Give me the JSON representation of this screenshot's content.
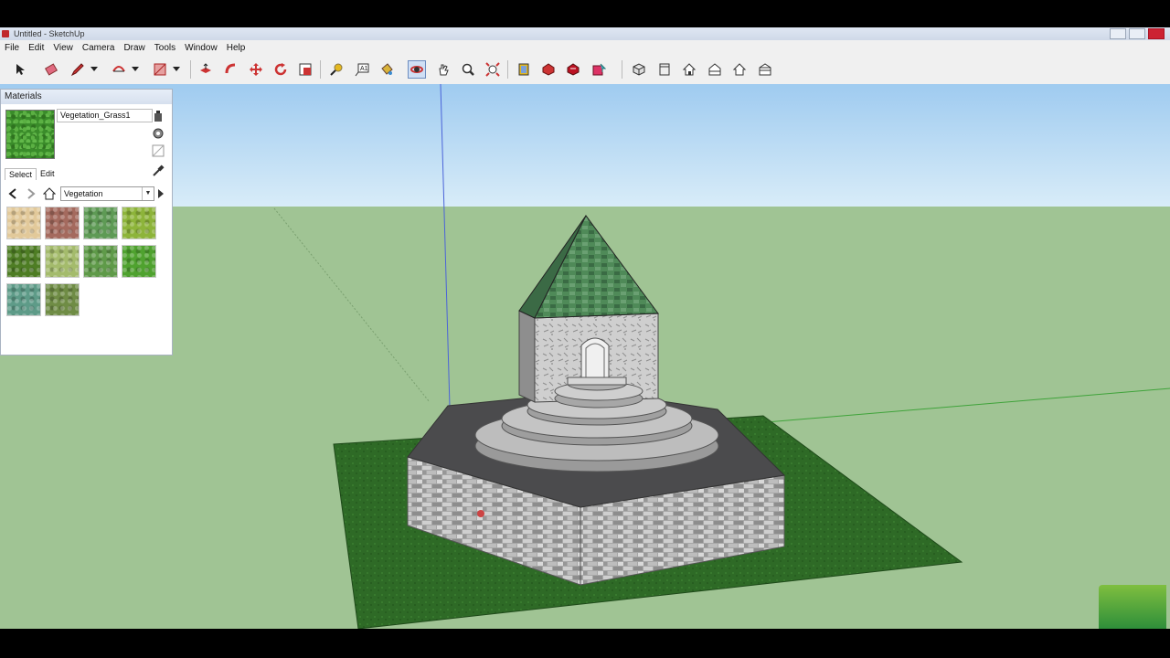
{
  "window": {
    "title": "Untitled - SketchUp"
  },
  "menu": [
    "File",
    "Edit",
    "View",
    "Camera",
    "Draw",
    "Tools",
    "Window",
    "Help"
  ],
  "toolbar": {
    "tools": [
      "select-icon",
      "eraser-icon",
      "pencil-icon",
      "pencil-dropdown-icon",
      "arc-icon",
      "arc-dropdown-icon",
      "rectangle-icon",
      "rectangle-dropdown-icon",
      "push-pull-icon",
      "follow-me-icon",
      "move-icon",
      "rotate-icon",
      "scale-icon",
      "tape-measure-icon",
      "text-icon",
      "paint-bucket-icon",
      "orbit-icon",
      "pan-icon",
      "zoom-icon",
      "zoom-extents-icon",
      "components-icon",
      "get-models-icon",
      "share-model-icon",
      "upload-icon",
      "iso-view-icon",
      "top-view-icon",
      "front-view-icon",
      "right-view-icon",
      "back-view-icon",
      "left-view-icon"
    ],
    "active_tool": "orbit-icon"
  },
  "materials": {
    "title": "Materials",
    "current_material": "Vegetation_Grass1",
    "tabs": [
      "Select",
      "Edit"
    ],
    "selected_tab": "Select",
    "library": "Vegetation",
    "swatches": [
      {
        "name": "sand",
        "color": "#e2c99a"
      },
      {
        "name": "brown-stones",
        "color": "#a46a5e"
      },
      {
        "name": "green-leaves",
        "color": "#5e9a55"
      },
      {
        "name": "moss",
        "color": "#8db43a"
      },
      {
        "name": "dark-moss",
        "color": "#4e7d24"
      },
      {
        "name": "pale-grass",
        "color": "#a4bb6c"
      },
      {
        "name": "flat-green",
        "color": "#5f9a49"
      },
      {
        "name": "bright-grass",
        "color": "#4fa22f"
      },
      {
        "name": "teal-leaves",
        "color": "#5e9b88"
      },
      {
        "name": "olive-grass",
        "color": "#6f8c45"
      }
    ]
  },
  "colors": {
    "sky_top": "#9fcbf0",
    "ground": "#a0c494",
    "grass": "#2f6a27"
  }
}
